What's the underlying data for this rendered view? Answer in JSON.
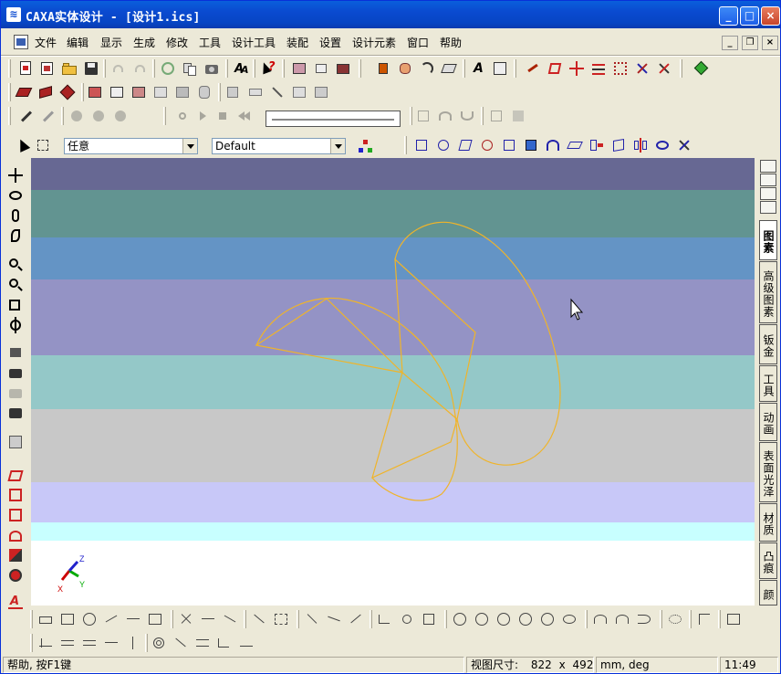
{
  "window": {
    "title": "CAXA实体设计 - [设计1.ics]",
    "min_label": "_",
    "max_label": "□",
    "close_label": "×"
  },
  "menubar": {
    "items": [
      "文件",
      "编辑",
      "显示",
      "生成",
      "修改",
      "工具",
      "设计工具",
      "装配",
      "设置",
      "设计元素",
      "窗口",
      "帮助"
    ],
    "mdi_min": "_",
    "mdi_restore": "❐",
    "mdi_close": "×"
  },
  "selection_bar": {
    "filter_value": "任意",
    "style_value": "Default"
  },
  "viewport": {
    "background_bands": [
      "#676893",
      "#629491",
      "#6494c5",
      "#9493c5",
      "#94c8c8",
      "#c8c8c8",
      "#c8c8f8",
      "#c8ffff",
      "#ffffff"
    ],
    "wire_color": "#f0b429",
    "axis_labels": [
      "X",
      "Y",
      "Z"
    ]
  },
  "right_panel": {
    "tabs": [
      "图素",
      "高级图素",
      "钣金",
      "工具",
      "动画",
      "表面光泽",
      "材质",
      "凸痕",
      "颜"
    ]
  },
  "statusbar": {
    "help_text": "帮助, 按F1键",
    "view_size_label": "视图尺寸:",
    "view_width": "822",
    "x_sep": "x",
    "view_height": "492",
    "units": "mm, deg",
    "time": "11:49"
  }
}
